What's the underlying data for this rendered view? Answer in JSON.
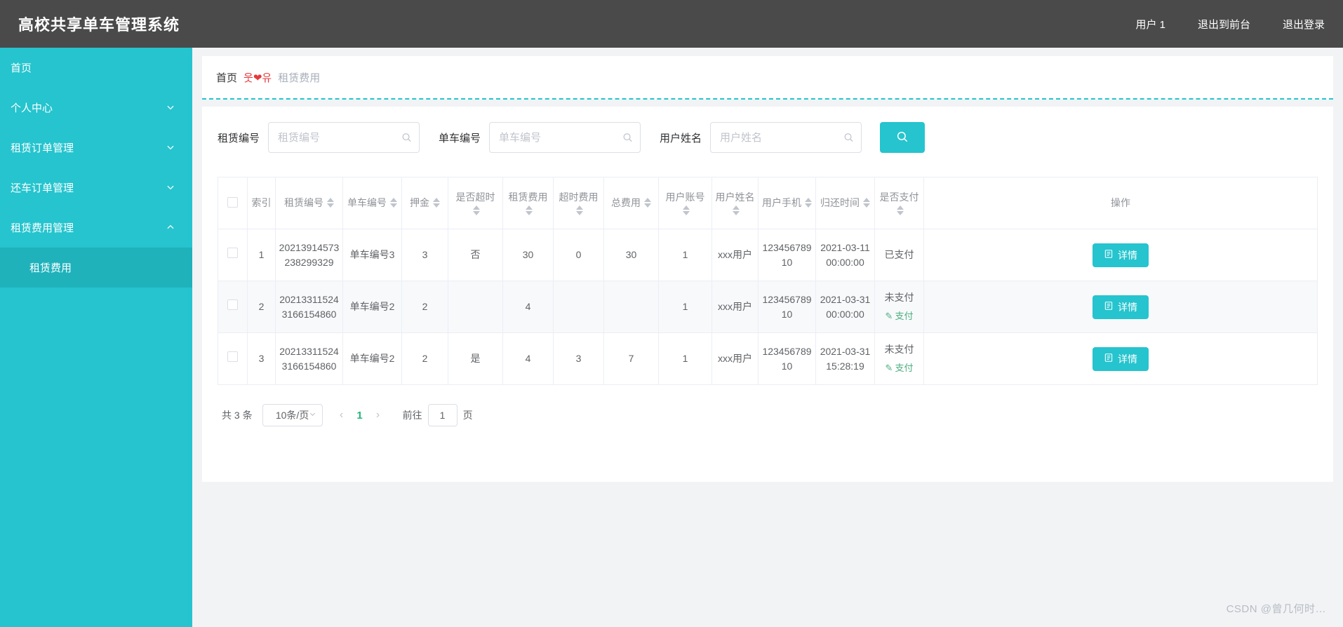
{
  "header": {
    "brand": "高校共享单车管理系统",
    "right_items": [
      {
        "label": "用户 1",
        "name": "user-label"
      },
      {
        "label": "退出到前台",
        "name": "exit-to-front"
      },
      {
        "label": "退出登录",
        "name": "logout"
      }
    ]
  },
  "sidebar": {
    "items": [
      {
        "label": "首页",
        "caret": "",
        "active": false
      },
      {
        "label": "个人中心",
        "caret": "down",
        "active": false
      },
      {
        "label": "租赁订单管理",
        "caret": "down",
        "active": false
      },
      {
        "label": "还车订单管理",
        "caret": "down",
        "active": false
      },
      {
        "label": "租赁费用管理",
        "caret": "up",
        "active": true
      }
    ],
    "submenu": [
      {
        "label": "租赁费用",
        "active": true
      }
    ]
  },
  "breadcrumb": {
    "home": "首页",
    "separator": "웃❤유",
    "current": "租赁费用"
  },
  "filters": {
    "fields": [
      {
        "label": "租赁编号",
        "placeholder": "租赁编号",
        "value": ""
      },
      {
        "label": "单车编号",
        "placeholder": "单车编号",
        "value": ""
      },
      {
        "label": "用户姓名",
        "placeholder": "用户姓名",
        "value": ""
      }
    ],
    "search_icon": "search-icon"
  },
  "table": {
    "columns": [
      {
        "key": "checkbox",
        "label": "",
        "sortable": false
      },
      {
        "key": "index",
        "label": "索引",
        "sortable": false
      },
      {
        "key": "rent_no",
        "label": "租赁编号",
        "sortable": true
      },
      {
        "key": "bike_no",
        "label": "单车编号",
        "sortable": true
      },
      {
        "key": "deposit",
        "label": "押金",
        "sortable": true
      },
      {
        "key": "overtime",
        "label": "是否超时",
        "sortable": true
      },
      {
        "key": "rent_fee",
        "label": "租赁费用",
        "sortable": true
      },
      {
        "key": "overtime_fee",
        "label": "超时费用",
        "sortable": true
      },
      {
        "key": "total_fee",
        "label": "总费用",
        "sortable": true
      },
      {
        "key": "user_account",
        "label": "用户账号",
        "sortable": true
      },
      {
        "key": "user_name",
        "label": "用户姓名",
        "sortable": true
      },
      {
        "key": "user_phone",
        "label": "用户手机",
        "sortable": true
      },
      {
        "key": "return_time",
        "label": "归还时间",
        "sortable": true
      },
      {
        "key": "paid",
        "label": "是否支付",
        "sortable": true
      },
      {
        "key": "action",
        "label": "操作",
        "sortable": false
      }
    ],
    "rows": [
      {
        "index": "1",
        "rent_no": "20213914573238299329",
        "bike_no": "单车编号3",
        "deposit": "3",
        "overtime": "否",
        "rent_fee": "30",
        "overtime_fee": "0",
        "total_fee": "30",
        "user_account": "1",
        "user_name": "xxx用户",
        "user_phone": "12345678910",
        "return_time": "2021-03-11 00:00:00",
        "paid": "已支付",
        "pay_link": "",
        "action_label": "详情"
      },
      {
        "index": "2",
        "rent_no": "202133115243166154860",
        "bike_no": "单车编号2",
        "deposit": "2",
        "overtime": "",
        "rent_fee": "4",
        "overtime_fee": "",
        "total_fee": "",
        "user_account": "1",
        "user_name": "xxx用户",
        "user_phone": "12345678910",
        "return_time": "2021-03-31 00:00:00",
        "paid": "未支付",
        "pay_link": "支付",
        "action_label": "详情"
      },
      {
        "index": "3",
        "rent_no": "202133115243166154860",
        "bike_no": "单车编号2",
        "deposit": "2",
        "overtime": "是",
        "rent_fee": "4",
        "overtime_fee": "3",
        "total_fee": "7",
        "user_account": "1",
        "user_name": "xxx用户",
        "user_phone": "12345678910",
        "return_time": "2021-03-31 15:28:19",
        "paid": "未支付",
        "pay_link": "支付",
        "action_label": "详情"
      }
    ]
  },
  "pagination": {
    "total_text": "共 3 条",
    "page_size": "10条/页",
    "prev": "‹",
    "next": "›",
    "current_page": "1",
    "jump_prefix": "前往",
    "jump_value": "1",
    "jump_suffix": "页"
  },
  "watermark": "CSDN @曾几何时…",
  "colors": {
    "accent": "#25c4ce",
    "topbar": "#4a4a4a",
    "submenu_active": "#1fb2bb",
    "pay_link": "#4cae7f",
    "page_active": "#26b47c",
    "crumb_sep": "#e4393c"
  }
}
